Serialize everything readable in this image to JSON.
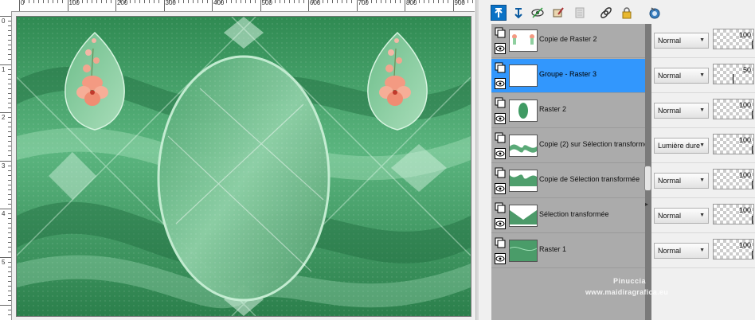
{
  "ruler": {
    "top_labels": [
      "0",
      "100",
      "200",
      "300",
      "400",
      "500",
      "600",
      "700",
      "800",
      "900"
    ],
    "left_labels": [
      "0",
      "1",
      "2",
      "3",
      "4",
      "5"
    ]
  },
  "toolbar": {
    "icons": [
      "move-layer-up-icon",
      "move-layer-down-icon",
      "visibility-toggle-icon",
      "edit-icon",
      "delete-layer-icon",
      "link-icon",
      "lock-icon",
      "mask-icon"
    ]
  },
  "layers": [
    {
      "name": "Copie de Raster 2",
      "blend": "Normal",
      "opacity": "100",
      "selected": false,
      "thumb": "flowers"
    },
    {
      "name": "Groupe - Raster 3",
      "blend": "Normal",
      "opacity": "50",
      "selected": true,
      "thumb": "blank"
    },
    {
      "name": "Raster 2",
      "blend": "Normal",
      "opacity": "100",
      "selected": false,
      "thumb": "oval"
    },
    {
      "name": "Copie (2) sur Sélection transformée",
      "blend": "Lumière dure",
      "opacity": "100",
      "selected": false,
      "thumb": "wave"
    },
    {
      "name": "Copie de Sélection transformée",
      "blend": "Normal",
      "opacity": "100",
      "selected": false,
      "thumb": "wave2"
    },
    {
      "name": "Sélection transformée",
      "blend": "Normal",
      "opacity": "100",
      "selected": false,
      "thumb": "wave3"
    },
    {
      "name": "Raster 1",
      "blend": "Normal",
      "opacity": "100",
      "selected": false,
      "thumb": "green"
    }
  ],
  "watermark": {
    "line1": "Pinuccia",
    "line2": "www.maidiragrafica.eu"
  },
  "colors": {
    "canvas_green": "#3f9a63",
    "canvas_light": "#8fd2a6",
    "selected_layer": "#3297fd",
    "layers_bg": "#ababab",
    "toolbar_active": "#0a72c6"
  }
}
